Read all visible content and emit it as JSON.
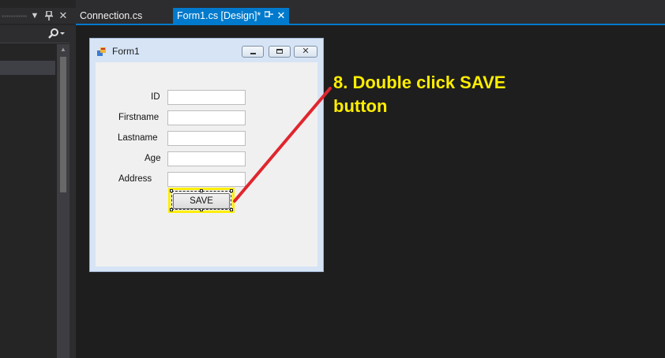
{
  "tabs": [
    {
      "label": "Connection.cs",
      "active": false
    },
    {
      "label": "Form1.cs [Design]*",
      "active": true
    }
  ],
  "form": {
    "title": "Form1",
    "fields": [
      {
        "label": "ID",
        "value": ""
      },
      {
        "label": "Firstname",
        "value": ""
      },
      {
        "label": "Lastname",
        "value": ""
      },
      {
        "label": "Age",
        "value": ""
      },
      {
        "label": "Address",
        "value": ""
      }
    ],
    "save_label": "SAVE"
  },
  "annotation": {
    "line1": "8. Double click SAVE",
    "line2": "button"
  },
  "colors": {
    "accent": "#007acc",
    "highlight": "#ffee00",
    "arrow": "#e0262e",
    "editor_bg": "#1e1e1e"
  },
  "icons": [
    "dropdown-arrow-icon",
    "pin-icon",
    "close-icon",
    "search-icon",
    "form-app-icon",
    "minimize-icon",
    "maximize-icon",
    "window-close-icon"
  ]
}
